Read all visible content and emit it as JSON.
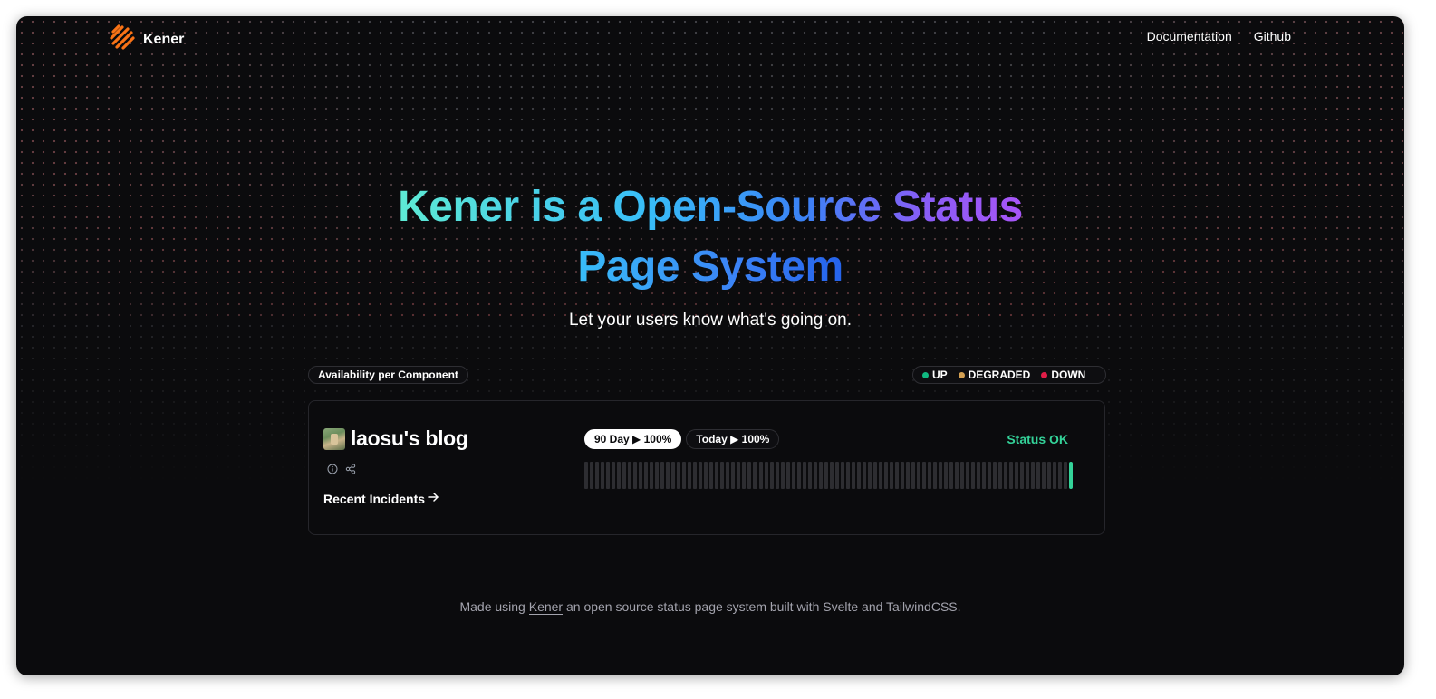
{
  "nav": {
    "brand": "Kener",
    "links": [
      "Documentation",
      "Github"
    ]
  },
  "hero": {
    "title_line1": "Kener is a Open-Source Status",
    "title_line2": "Page System",
    "subtitle": "Let your users know what's going on."
  },
  "section": {
    "availability_label": "Availability per Component"
  },
  "legend": [
    {
      "label": "UP",
      "color": "#10b981"
    },
    {
      "label": "DEGRADED",
      "color": "#d4a052"
    },
    {
      "label": "DOWN",
      "color": "#e11d48"
    }
  ],
  "monitor": {
    "name": "laosu's blog",
    "recent_incidents": "Recent Incidents",
    "tabs": [
      {
        "label": "90 Day ▶ 100%",
        "active": true
      },
      {
        "label": "Today ▶ 100%",
        "active": false
      }
    ],
    "status": "Status OK",
    "bar_count": 90,
    "bar_colors": {
      "nodata": "#2d2d31",
      "up": "#34d399"
    },
    "icons": [
      "info-icon",
      "share-icon"
    ]
  },
  "footer": {
    "prefix": "Made using",
    "link": "Kener",
    "suffix": "an open source status page system built with Svelte and TailwindCSS."
  }
}
